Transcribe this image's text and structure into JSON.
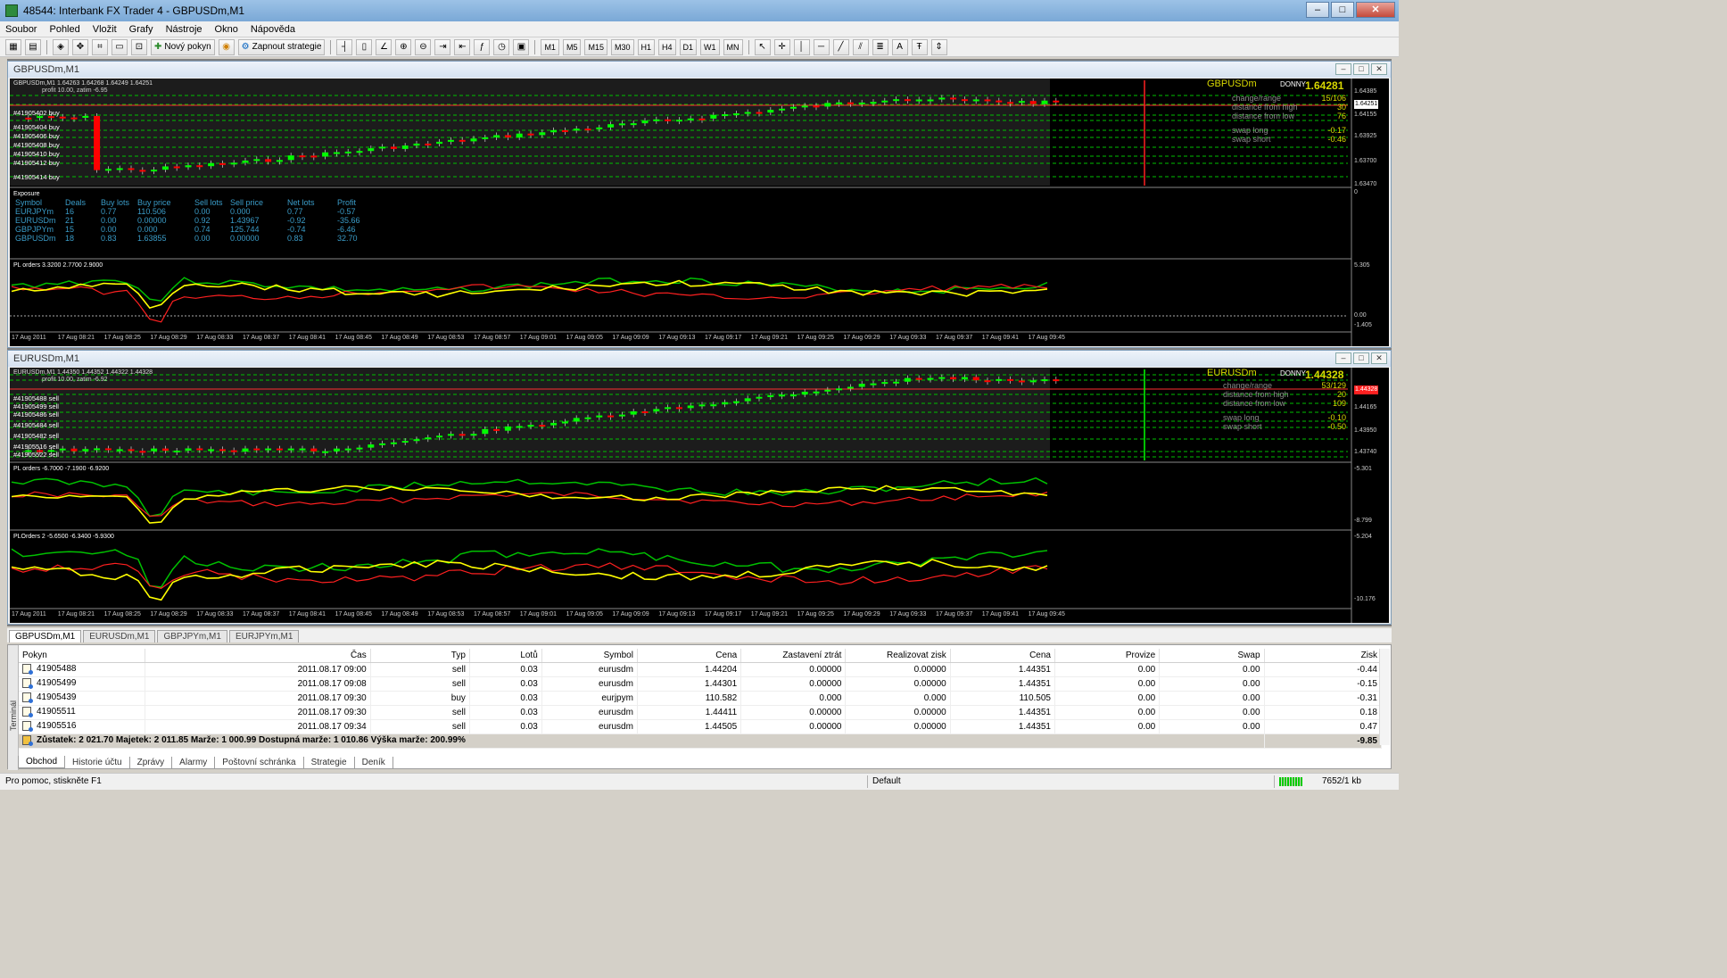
{
  "window": {
    "title": "48544: Interbank FX Trader 4 - GBPUSDm,M1"
  },
  "menu": [
    "Soubor",
    "Pohled",
    "Vložit",
    "Grafy",
    "Nástroje",
    "Okno",
    "Nápověda"
  ],
  "toolbar": {
    "new_order_label": "Nový pokyn",
    "strategy_label": "Zapnout strategie",
    "timeframes": [
      "M1",
      "M5",
      "M15",
      "M30",
      "H1",
      "H4",
      "D1",
      "W1",
      "MN"
    ],
    "text_tool": "A"
  },
  "charts": [
    {
      "window_title": "GBPUSDm,M1",
      "ohlc": "GBPUSDm,M1  1.64263 1.64268 1.64249 1.64251",
      "profit_note": "profit 10.00, zatim -6.95",
      "symbol_label": "GBPUSDm",
      "donny_label": "DONNY",
      "price_big": "1.64281",
      "info_rows": [
        {
          "label": "change/range",
          "value": "15/106"
        },
        {
          "label": "distance from high",
          "value": "30"
        },
        {
          "label": "distance from low",
          "value": "76"
        },
        {
          "label": "swap long",
          "value": "-0.17"
        },
        {
          "label": "swap short",
          "value": "-0.46"
        }
      ],
      "price_scale": [
        "1.64385",
        "1.64251",
        "1.64155",
        "1.63925",
        "1.63700",
        "1.63470"
      ],
      "order_labels": [
        "#41905402 buy",
        "#41905404 buy",
        "#41905406 buy",
        "#41905408 buy",
        "#41905410 buy",
        "#41905412 buy",
        "#41905414 buy"
      ],
      "exposure": {
        "title": "Exposure",
        "headers": [
          "Symbol",
          "Deals",
          "Buy lots",
          "Buy price",
          "Sell lots",
          "Sell price",
          "Net lots",
          "Profit"
        ],
        "rows": [
          [
            "EURJPYm",
            "16",
            "0.77",
            "110.506",
            "0.00",
            "0.000",
            "0.77",
            "-0.57"
          ],
          [
            "EURUSDm",
            "21",
            "0.00",
            "0.00000",
            "0.92",
            "1.43967",
            "-0.92",
            "-35.66"
          ],
          [
            "GBPJPYm",
            "15",
            "0.00",
            "0.000",
            "0.74",
            "125.744",
            "-0.74",
            "-6.46"
          ],
          [
            "GBPUSDm",
            "18",
            "0.83",
            "1.63855",
            "0.00",
            "0.00000",
            "0.83",
            "32.70"
          ]
        ],
        "scale_top": "0"
      },
      "pl_indicator": {
        "label": "PL orders 3.3200 2.7700 2.9000",
        "scale": [
          "5.305",
          "0.00",
          "-1.405"
        ]
      }
    },
    {
      "window_title": "EURUSDm,M1",
      "ohlc": "EURUSDm,M1  1.44350 1.44352 1.44322 1.44328",
      "profit_note": "profit 10.00, zatim -6.92",
      "symbol_label": "EURUSDm",
      "donny_label": "DONNY",
      "price_big": "1.44328",
      "info_rows": [
        {
          "label": "change/range",
          "value": "53/129"
        },
        {
          "label": "distance from high",
          "value": "20"
        },
        {
          "label": "distance from low",
          "value": "109"
        },
        {
          "label": "swap long",
          "value": "-0.10"
        },
        {
          "label": "swap short",
          "value": "-0.50"
        }
      ],
      "price_scale": [
        "1.44328",
        "1.44165",
        "1.43950",
        "1.43740"
      ],
      "order_labels": [
        "#41905488 sell",
        "#41905499 sell",
        "#41905486 sell",
        "#41905484 sell",
        "#41905482 sell",
        "#41905516 sell",
        "#41905522 sell"
      ],
      "pl_indicator": {
        "label": "PL orders -6.7000 -7.1900 -6.9200",
        "scale": [
          "-5.301",
          "-8.799"
        ]
      },
      "pl_indicator2": {
        "label": "PLOrders 2 -5.6500 -6.3400 -5.9300",
        "scale": [
          "-5.204",
          "-10.176"
        ]
      }
    }
  ],
  "time_axis": [
    "17 Aug 2011",
    "17 Aug 08:21",
    "17 Aug 08:25",
    "17 Aug 08:29",
    "17 Aug 08:33",
    "17 Aug 08:37",
    "17 Aug 08:41",
    "17 Aug 08:45",
    "17 Aug 08:49",
    "17 Aug 08:53",
    "17 Aug 08:57",
    "17 Aug 09:01",
    "17 Aug 09:05",
    "17 Aug 09:09",
    "17 Aug 09:13",
    "17 Aug 09:17",
    "17 Aug 09:21",
    "17 Aug 09:25",
    "17 Aug 09:29",
    "17 Aug 09:33",
    "17 Aug 09:37",
    "17 Aug 09:41",
    "17 Aug 09:45"
  ],
  "chart_tabs": [
    "GBPUSDm,M1",
    "EURUSDm,M1",
    "GBPJPYm,M1",
    "EURJPYm,M1"
  ],
  "terminal": {
    "side_label": "Terminál",
    "headers": [
      "Pokyn",
      "Čas",
      "Typ",
      "Lotů",
      "Symbol",
      "Cena",
      "Zastavení ztrát",
      "Realizovat zisk",
      "Cena",
      "Provize",
      "Swap",
      "Zisk"
    ],
    "rows": [
      [
        "41905488",
        "2011.08.17 09:00",
        "sell",
        "0.03",
        "eurusdm",
        "1.44204",
        "0.00000",
        "0.00000",
        "1.44351",
        "0.00",
        "0.00",
        "-0.44"
      ],
      [
        "41905499",
        "2011.08.17 09:08",
        "sell",
        "0.03",
        "eurusdm",
        "1.44301",
        "0.00000",
        "0.00000",
        "1.44351",
        "0.00",
        "0.00",
        "-0.15"
      ],
      [
        "41905439",
        "2011.08.17 09:30",
        "buy",
        "0.03",
        "eurjpym",
        "110.582",
        "0.000",
        "0.000",
        "110.505",
        "0.00",
        "0.00",
        "-0.31"
      ],
      [
        "41905511",
        "2011.08.17 09:30",
        "sell",
        "0.03",
        "eurusdm",
        "1.44411",
        "0.00000",
        "0.00000",
        "1.44351",
        "0.00",
        "0.00",
        "0.18"
      ],
      [
        "41905516",
        "2011.08.17 09:34",
        "sell",
        "0.03",
        "eurusdm",
        "1.44505",
        "0.00000",
        "0.00000",
        "1.44351",
        "0.00",
        "0.00",
        "0.47"
      ]
    ],
    "summary": "Zůstatek: 2 021.70  Majetek: 2 011.85  Marže: 1 000.99  Dostupná marže: 1 010.86  Výška marže: 200.99%",
    "summary_profit": "-9.85",
    "tabs": [
      "Obchod",
      "Historie účtu",
      "Zprávy",
      "Alarmy",
      "Poštovní schránka",
      "Strategie",
      "Deník"
    ]
  },
  "status": {
    "help": "Pro pomoc, stiskněte F1",
    "profile": "Default",
    "traffic": "7652/1 kb"
  },
  "colors": {
    "candle_up": "#00ff00",
    "candle_down": "#ff0000",
    "pl_line_1": "#00c000",
    "pl_line_2": "#ffff00",
    "pl_line_3": "#ff2020",
    "chart_bg": "#000000",
    "label_grey": "#909090"
  }
}
